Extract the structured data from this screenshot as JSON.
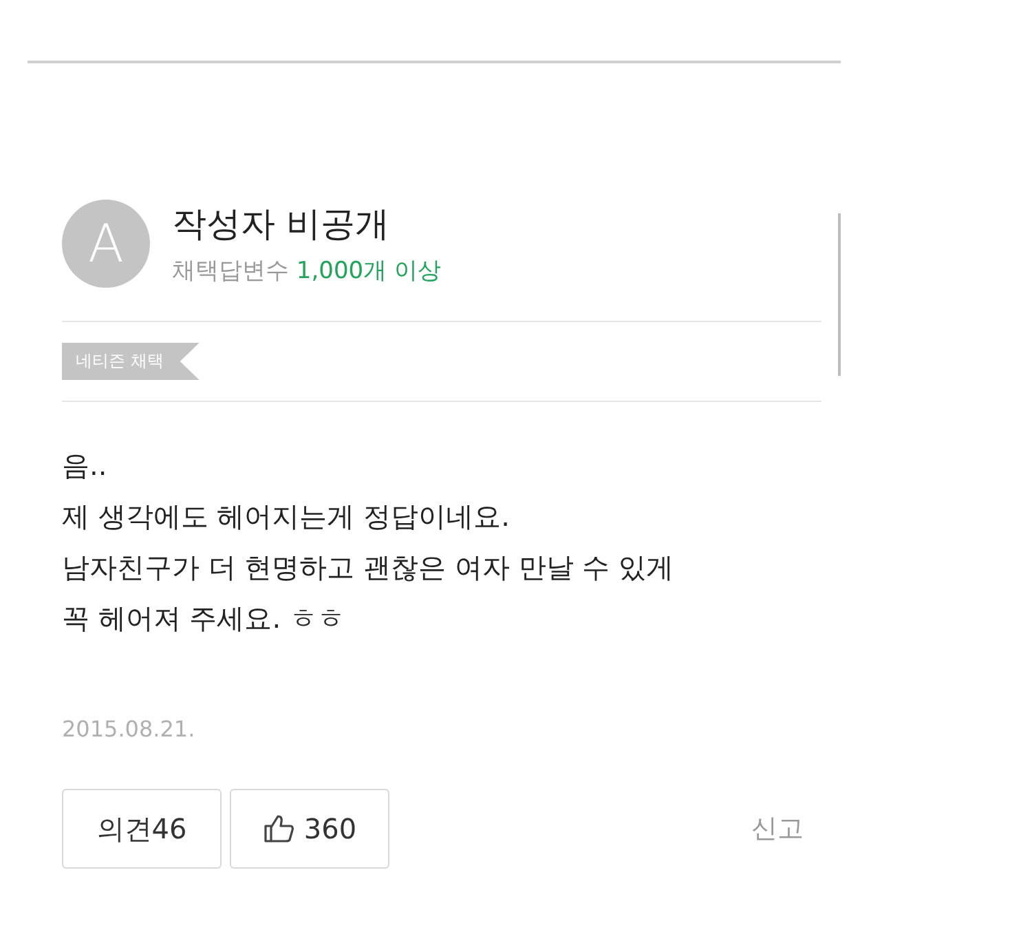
{
  "author": {
    "avatar_letter": "A",
    "name": "작성자 비공개",
    "stat_label": "채택답변수",
    "stat_value": "1,000개 이상"
  },
  "badge": "네티즌 채택",
  "answer_lines": [
    "음..",
    "제 생각에도 헤어지는게 정답이네요.",
    "남자친구가 더 현명하고 괜찮은 여자 만날 수 있게",
    "꼭 헤어져 주세요. ㅎㅎ"
  ],
  "date": "2015.08.21.",
  "actions": [
    {
      "kind": "comment",
      "label": "의견",
      "count": "46"
    },
    {
      "kind": "like",
      "count": "360"
    }
  ],
  "report": "신고"
}
